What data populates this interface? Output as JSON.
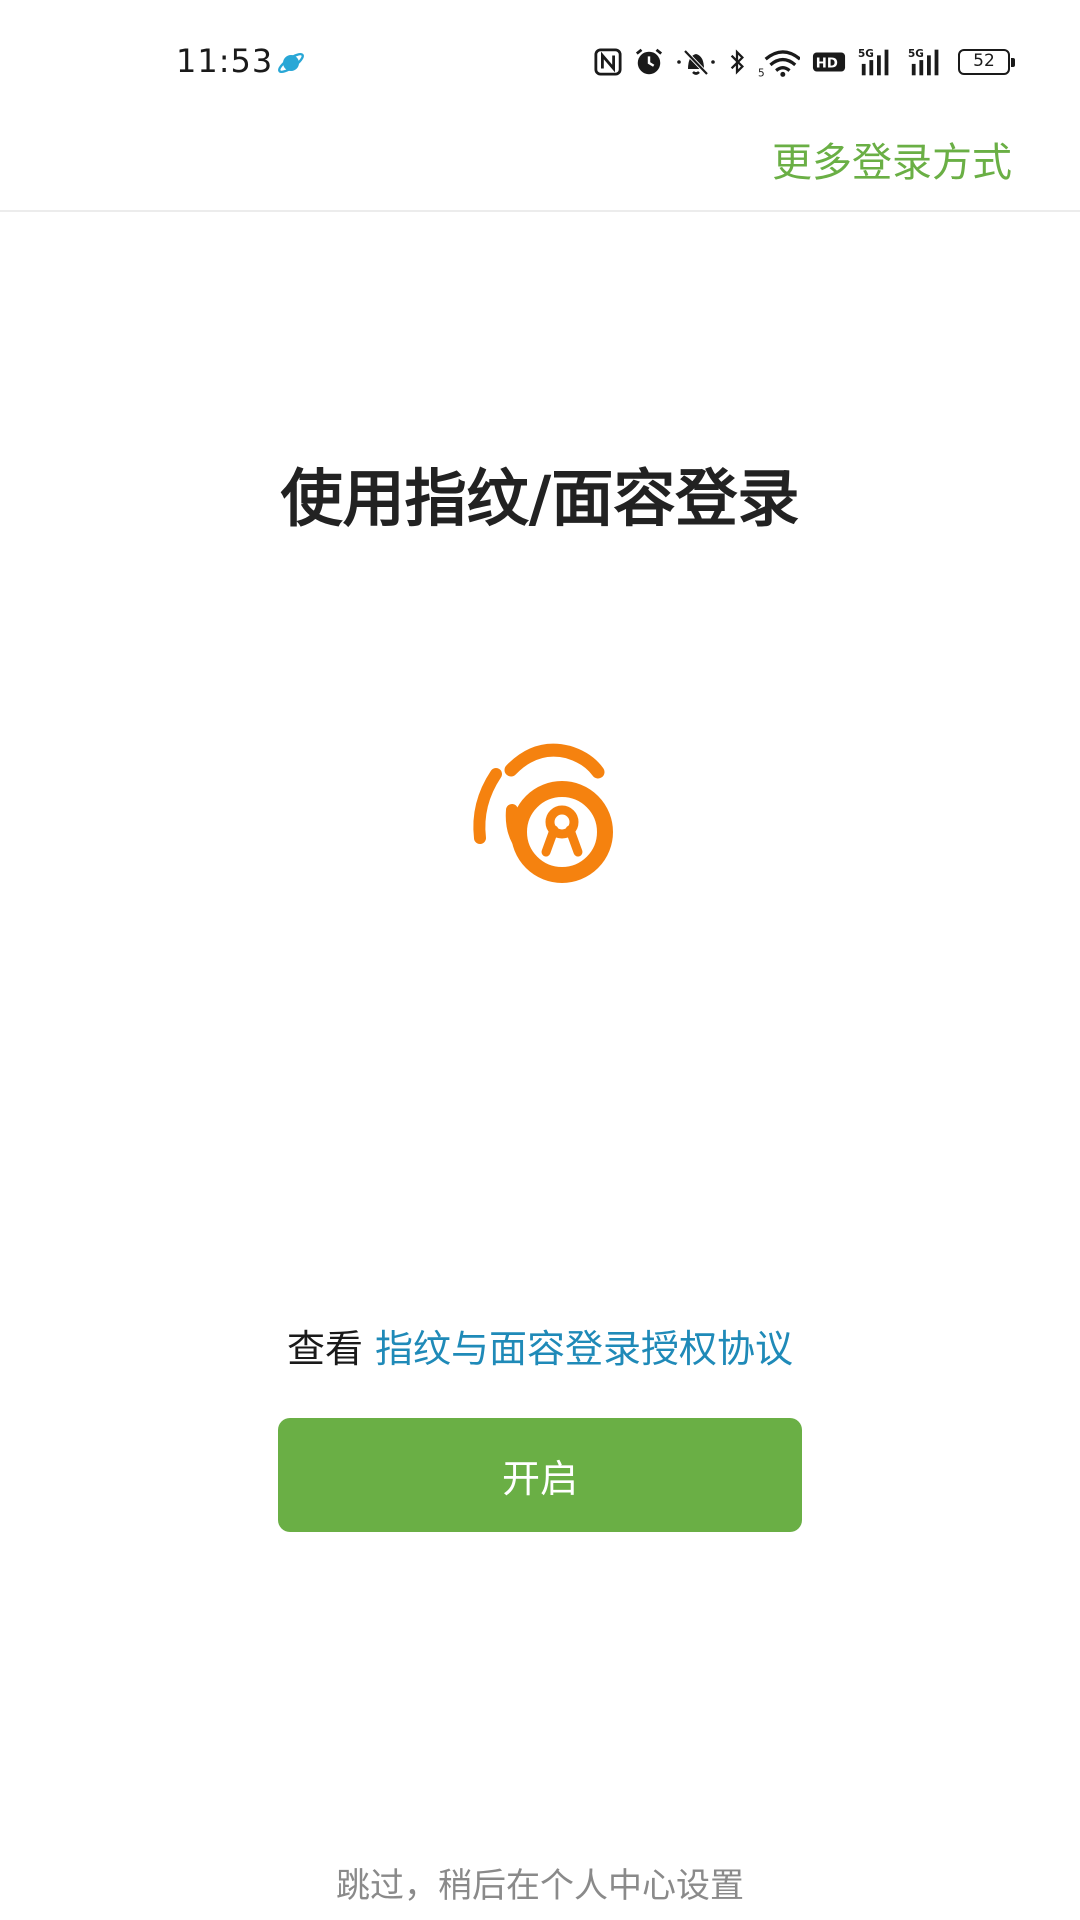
{
  "status_bar": {
    "time": "11:53",
    "left_icon": "planet-icon",
    "icons": [
      "nfc-icon",
      "alarm-icon",
      "mute-icon",
      "bluetooth-icon",
      "wifi-icon",
      "hd-icon",
      "signal-5g-icon",
      "signal-5g-icon"
    ],
    "battery": "52"
  },
  "header": {
    "more_login_label": "更多登录方式"
  },
  "main": {
    "title": "使用指纹/面容登录",
    "logo_icon": "fingerprint-lock-icon",
    "agreement_prefix": "查看",
    "agreement_link": "指纹与面容登录授权协议",
    "enable_button_label": "开启",
    "skip_label": "跳过，稍后在个人中心设置"
  },
  "colors": {
    "accent_green": "#6aaf45",
    "link_blue": "#1f8ab8",
    "logo_orange": "#f5820f"
  }
}
